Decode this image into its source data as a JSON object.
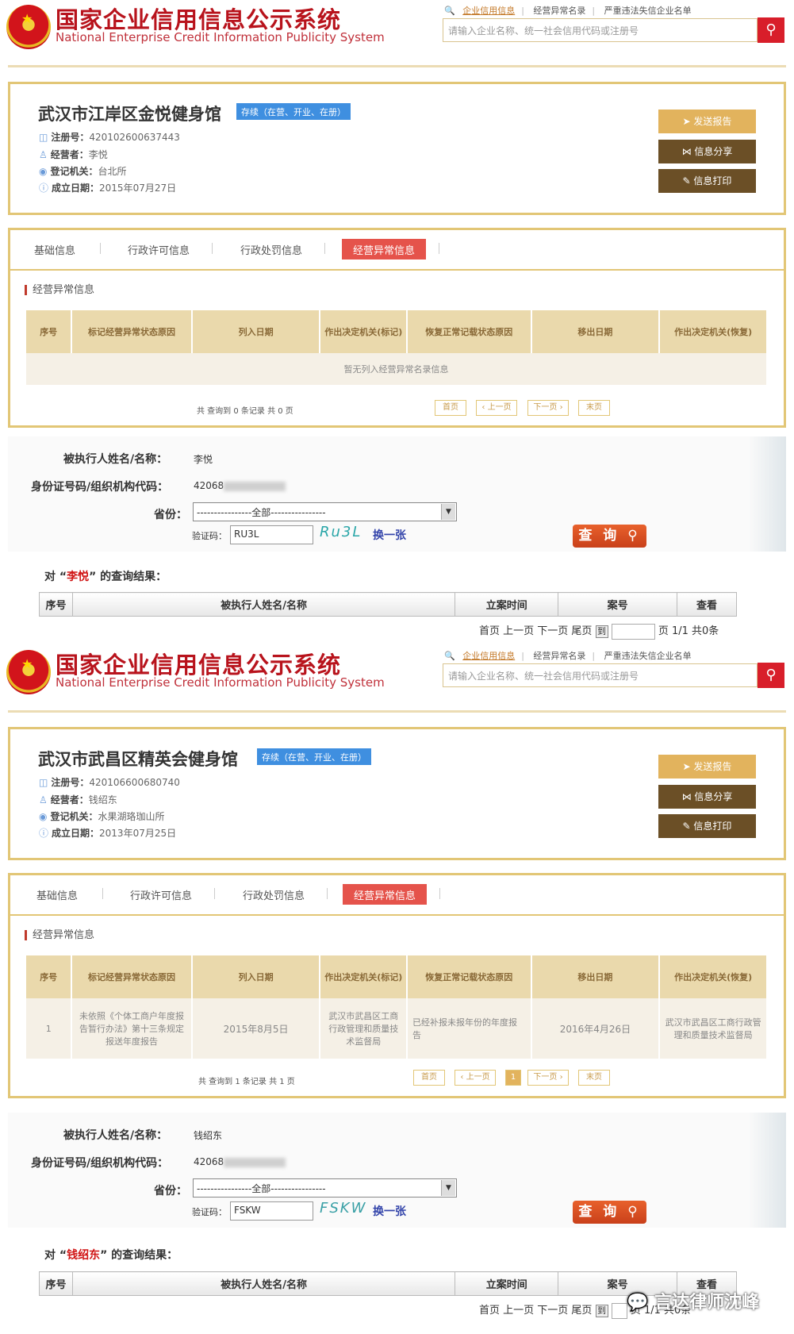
{
  "colors": {
    "brand_red": "#b8131c",
    "gold_border": "#e2c676",
    "status_blue": "#3f8fe0",
    "tab_active": "#e5534b",
    "query_orange": "#d9511f"
  },
  "header": {
    "title": "国家企业信用信息公示系统",
    "subtitle": "National Enterprise Credit Information Publicity System",
    "links": [
      "企业信用信息",
      "经营异常名录",
      "严重违法失信企业名单"
    ],
    "search_placeholder": "请输入企业名称、统一社会信用代码或注册号"
  },
  "labels": {
    "reg_no": "注册号：",
    "operator": "经营者：",
    "reg_authority": "登记机关：",
    "established": "成立日期：",
    "btn_report": "发送报告",
    "btn_share": "信息分享",
    "btn_print": "信息打印",
    "tabs": [
      "基础信息",
      "行政许可信息",
      "行政处罚信息",
      "经营异常信息"
    ],
    "section_title": "经营异常信息",
    "table_headers": [
      "序号",
      "标记经营异常状态原因",
      "列入日期",
      "作出决定机关(标记)",
      "恢复正常记载状态原因",
      "移出日期",
      "作出决定机关(恢复)"
    ],
    "pager": [
      "首页",
      "‹ 上一页",
      "下一页 ›",
      "末页"
    ],
    "q_name": "被执行人姓名/名称：",
    "q_id": "身份证号码/组织机构代码：",
    "q_province": "省份：",
    "q_province_value": "----------------全部----------------",
    "q_captcha": "验证码：",
    "q_swap": "换一张",
    "q_button": "查 询",
    "result_headers": [
      "序号",
      "被执行人姓名/名称",
      "立案时间",
      "案号",
      "查看"
    ],
    "result_pager_nav": "首页 上一页 下一页 尾页",
    "result_pager_go": "到"
  },
  "records": [
    {
      "company": "武汉市江岸区金悦健身馆",
      "status": "存续（在营、开业、在册）",
      "reg_no": "420102600637443",
      "operator": "李悦",
      "reg_authority": "台北所",
      "established": "2015年07月27日",
      "empty_text": "暂无列入经营异常名录信息",
      "pager_total": "共 查询到 0 条记录 共 0 页",
      "query": {
        "name_value": "李悦",
        "id_prefix": "42068",
        "captcha_value": "RU3L",
        "captcha_image": "Ru3L",
        "result_prefix": "对 “",
        "result_name": "李悦",
        "result_suffix": "” 的查询结果：",
        "pager_info": "页 1/1 共0条"
      }
    },
    {
      "company": "武汉市武昌区精英会健身馆",
      "status": "存续（在营、开业、在册）",
      "reg_no": "420106600680740",
      "operator": "钱绍东",
      "reg_authority": "水果湖珞珈山所",
      "established": "2013年07月25日",
      "row": {
        "no": "1",
        "reason": "未依照《个体工商户年度报告暂行办法》第十三条规定报送年度报告",
        "date_in": "2015年8月5日",
        "authority_in": "武汉市武昌区工商行政管理和质量技术监督局",
        "restore_reason": "已经补报未报年份的年度报告",
        "date_out": "2016年4月26日",
        "authority_out": "武汉市武昌区工商行政管理和质量技术监督局"
      },
      "pager_total": "共 查询到 1 条记录 共 1 页",
      "current_page": "1",
      "query": {
        "name_value": "钱绍东",
        "id_prefix": "42068",
        "captcha_value": "FSKW",
        "captcha_image": "FSKW",
        "result_prefix": "对 “",
        "result_name": "钱绍东",
        "result_suffix": "” 的查询结果：",
        "pager_info": "页 1/1 共0条"
      }
    }
  ],
  "watermark": "言达律师沈峰"
}
